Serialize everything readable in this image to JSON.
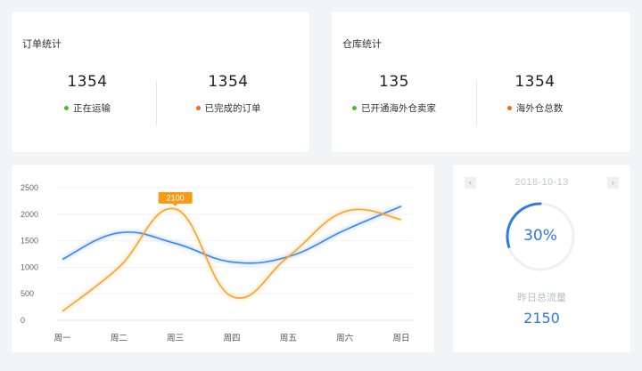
{
  "orders_card": {
    "title": "订单统计",
    "stats": [
      {
        "value": "1354",
        "label": "正在运输",
        "dot_color": "#52b72c"
      },
      {
        "value": "1354",
        "label": "已完成的订单",
        "dot_color": "#f36b1c"
      }
    ]
  },
  "warehouse_card": {
    "title": "仓库统计",
    "stats": [
      {
        "value": "135",
        "label": "已开通海外仓卖家",
        "dot_color": "#52b72c"
      },
      {
        "value": "1354",
        "label": "海外仓总数",
        "dot_color": "#f36b1c"
      }
    ]
  },
  "side_card": {
    "date": "2018-10-13",
    "prev_icon": "chevron-left-icon",
    "next_icon": "chevron-right-icon",
    "gauge_percent": "30%",
    "gauge_fraction": 0.3,
    "label": "昨日总流量",
    "value": "2150",
    "accent_color": "#2f79e3"
  },
  "chart_data": {
    "type": "line",
    "categories": [
      "周一",
      "周二",
      "周三",
      "周四",
      "周五",
      "周六",
      "周日"
    ],
    "y_ticks": [
      "0",
      "500",
      "1000",
      "1500",
      "2000",
      "2500"
    ],
    "ylim": [
      0,
      2500
    ],
    "grid": true,
    "series": [
      {
        "color": "#3a86f0",
        "values": [
          1150,
          1650,
          1450,
          1100,
          1200,
          1700,
          2150
        ]
      },
      {
        "color": "#f7a22c",
        "values": [
          170,
          1000,
          2100,
          450,
          1200,
          2050,
          1900
        ]
      }
    ],
    "annotation": {
      "text": "2100",
      "category_index": 2,
      "series_index": 1,
      "color": "#f79a16"
    }
  }
}
